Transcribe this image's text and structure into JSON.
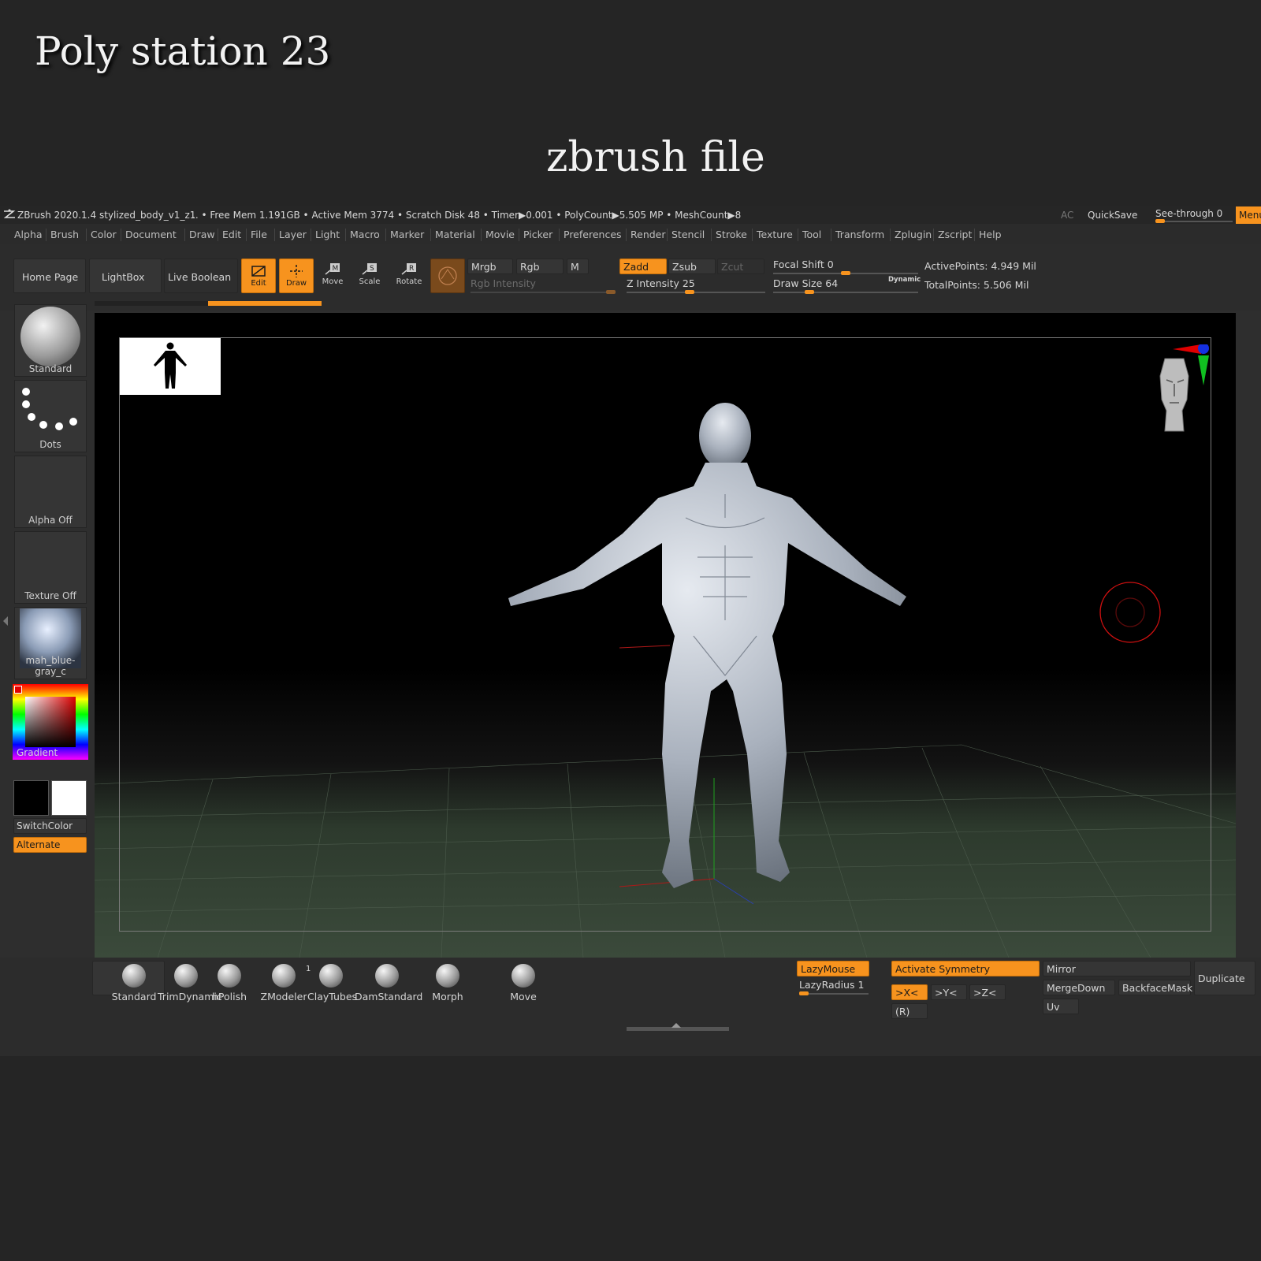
{
  "heading": {
    "title": "Poly station 23",
    "subtitle": "zbrush file"
  },
  "titlebar": {
    "app": "ZBrush 2020.1.4",
    "file": "stylized_body_v1_z1",
    "stats": ".. • Free Mem 1.191GB • Active Mem 3774 • Scratch Disk 48 • Timer▶0.001 • PolyCount▶5.505 MP • MeshCount▶8",
    "ac": "AC",
    "quicksave": "QuickSave",
    "see_through": "See-through  0",
    "menus": "Menus"
  },
  "menubar": [
    "Alpha",
    "Brush",
    "Color",
    "Document",
    "Draw",
    "Edit",
    "File",
    "Layer",
    "Light",
    "Macro",
    "Marker",
    "Material",
    "Movie",
    "Picker",
    "Preferences",
    "Render",
    "Stencil",
    "Stroke",
    "Texture",
    "Tool",
    "Transform",
    "Zplugin",
    "Zscript",
    "Help"
  ],
  "toolbar": {
    "home": "Home Page",
    "lightbox": "LightBox",
    "live_boolean": "Live Boolean",
    "edit": "Edit",
    "draw": "Draw",
    "move": "Move",
    "scale": "Scale",
    "rotate": "Rotate",
    "mrgb": "Mrgb",
    "rgb": "Rgb",
    "m": "M",
    "rgb_intensity": "Rgb Intensity",
    "zadd": "Zadd",
    "zsub": "Zsub",
    "zcut": "Zcut",
    "z_intensity": "Z Intensity 25",
    "z_intensity_value": 25,
    "focal_shift": "Focal Shift 0",
    "focal_shift_value": 0,
    "draw_size": "Draw Size 64",
    "draw_size_value": 64,
    "dynamic": "Dynamic",
    "active_points": "ActivePoints: 4.949 Mil",
    "total_points": "TotalPoints: 5.506 Mil"
  },
  "shelf": {
    "brush": "Standard",
    "stroke": "Dots",
    "alpha": "Alpha Off",
    "texture": "Texture Off",
    "material": "mah_blue-gray_c",
    "gradient": "Gradient",
    "switch_color": "SwitchColor",
    "alternate": "Alternate"
  },
  "bottom": {
    "brushes": [
      {
        "label": "Standard"
      },
      {
        "label": "TrimDynamic"
      },
      {
        "label": "hPolish"
      },
      {
        "label": "ZModeler"
      },
      {
        "label": "ClayTubes"
      },
      {
        "label": "DamStandard"
      },
      {
        "label": "Morph"
      },
      {
        "label": "Move"
      }
    ],
    "badge": "1",
    "lazymouse": "LazyMouse",
    "lazyradius": "LazyRadius 1",
    "activate_symmetry": "Activate Symmetry",
    "x": ">X<",
    "y": ">Y<",
    "z": ">Z<",
    "r": "(R)",
    "mirror": "Mirror",
    "mergedown": "MergeDown",
    "backfacemask": "BackfaceMask",
    "uv": "Uv",
    "duplicate": "Duplicate"
  },
  "colors": {
    "accent": "#f7931e",
    "panel": "#353535",
    "background": "#252525"
  }
}
